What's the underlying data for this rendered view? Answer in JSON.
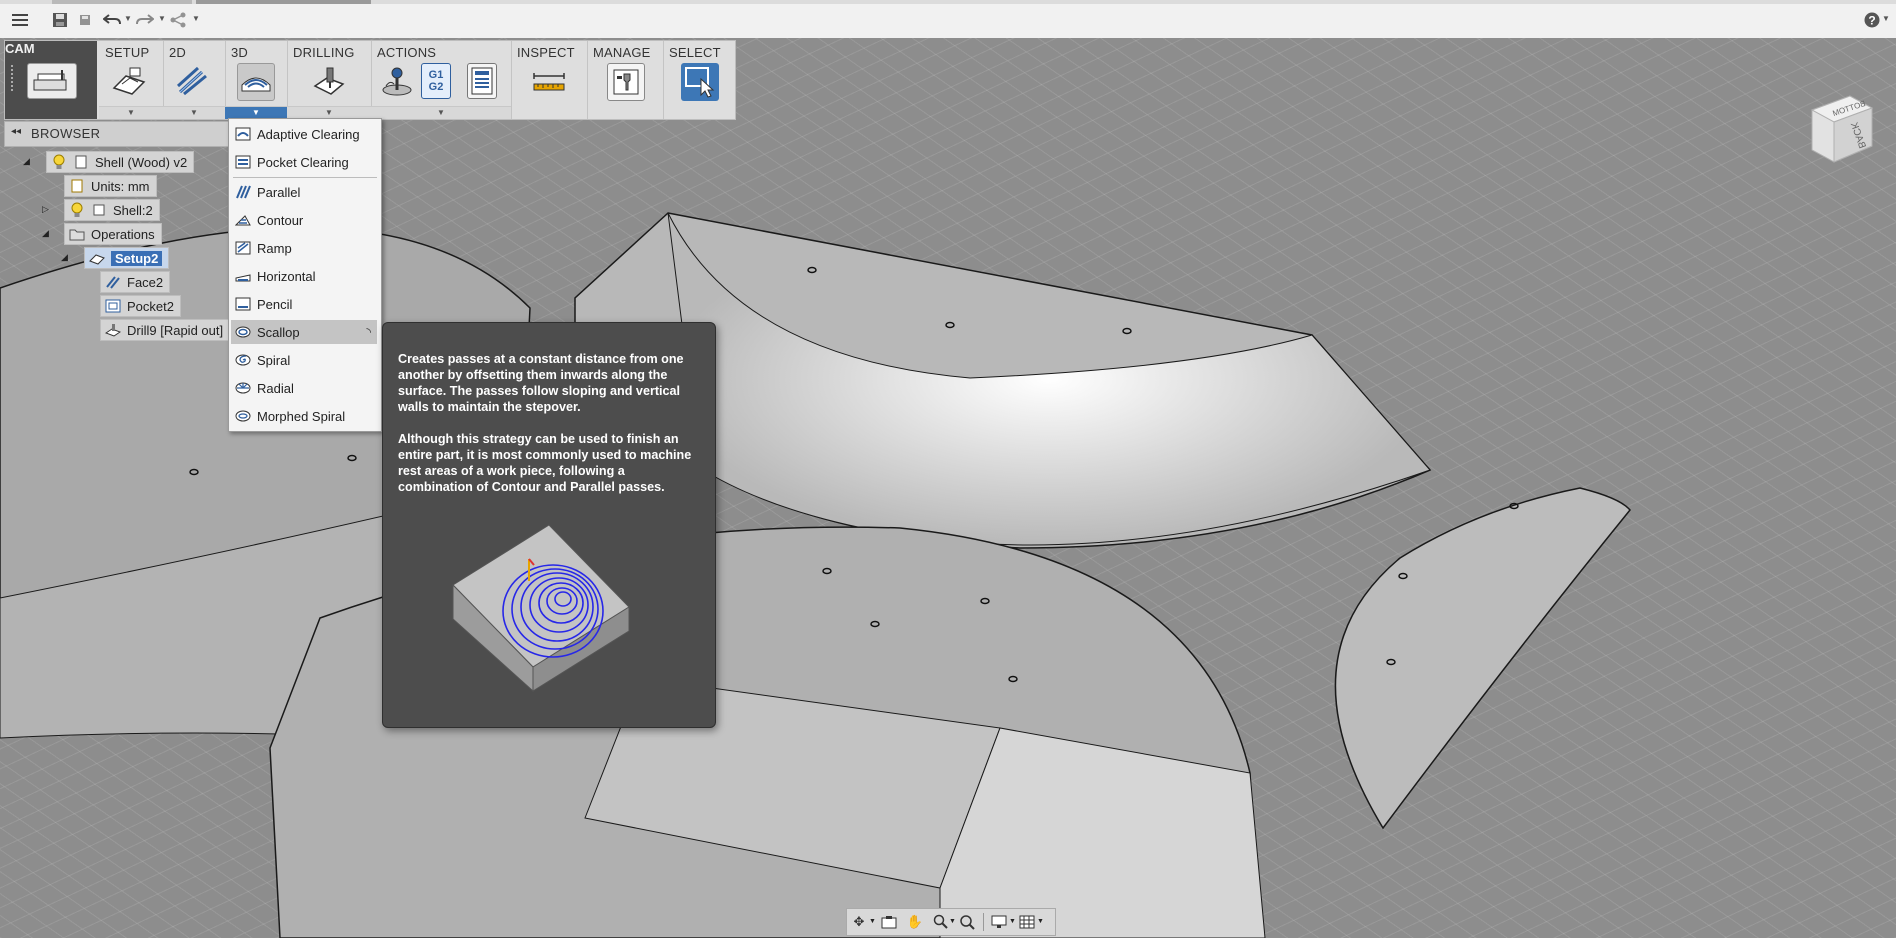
{
  "toolbar": {
    "workspace": "CAM",
    "groups": [
      {
        "label": "SETUP"
      },
      {
        "label": "2D"
      },
      {
        "label": "3D"
      },
      {
        "label": "DRILLING"
      },
      {
        "label": "ACTIONS"
      },
      {
        "label": "INSPECT"
      },
      {
        "label": "MANAGE"
      },
      {
        "label": "SELECT"
      }
    ],
    "gcode_label": "G1\nG2"
  },
  "browser": {
    "title": "BROWSER",
    "nodes": [
      {
        "label": "Shell (Wood) v2"
      },
      {
        "label": "Units: mm"
      },
      {
        "label": "Shell:2"
      },
      {
        "label": "Operations"
      },
      {
        "label": "Setup2"
      },
      {
        "label": "Face2"
      },
      {
        "label": "Pocket2"
      },
      {
        "label": "Drill9 [Rapid out]"
      }
    ]
  },
  "menu_3d": {
    "items": [
      {
        "label": "Adaptive Clearing"
      },
      {
        "label": "Pocket Clearing"
      },
      {
        "label": "Parallel"
      },
      {
        "label": "Contour"
      },
      {
        "label": "Ramp"
      },
      {
        "label": "Horizontal"
      },
      {
        "label": "Pencil"
      },
      {
        "label": "Scallop"
      },
      {
        "label": "Spiral"
      },
      {
        "label": "Radial"
      },
      {
        "label": "Morphed Spiral"
      }
    ],
    "hovered": "Scallop"
  },
  "tooltip": {
    "para1": "Creates passes at a constant distance from one another by offsetting them inwards along the surface. The passes follow sloping and vertical walls to maintain the stepover.",
    "para2": "Although this strategy can be used to finish an entire part, it is most commonly used to machine rest areas of a work piece, following a combination of Contour and Parallel passes."
  },
  "viewcube": {
    "faces": [
      "BOTTOM",
      "BACK"
    ]
  },
  "colors": {
    "accent": "#3d77b6",
    "toolbar_bg": "#dedede",
    "tooltip_bg": "#4d4d4d"
  }
}
